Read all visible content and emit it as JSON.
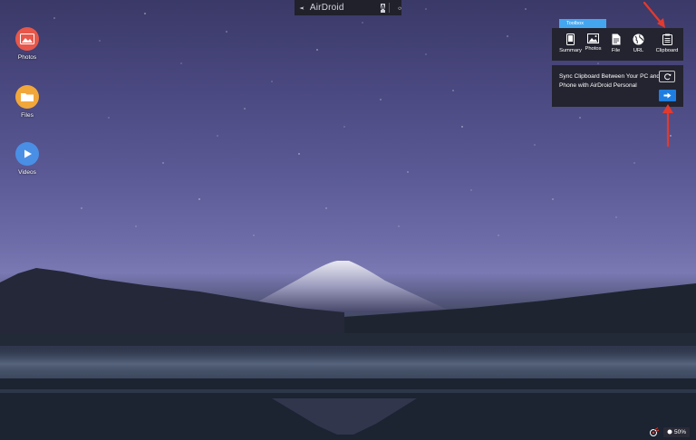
{
  "topbar": {
    "brand": "AirDroid",
    "account_letter": "A",
    "logo_icon": "paper-plane-icon",
    "power_icon": "power-icon"
  },
  "desktop": {
    "icons": [
      {
        "label": "Photos",
        "icon": "photos-icon",
        "color": "#e8574a"
      },
      {
        "label": "Files",
        "icon": "folder-icon",
        "color": "#f1a73a"
      },
      {
        "label": "Videos",
        "icon": "play-icon",
        "color": "#4a8fe6"
      }
    ]
  },
  "toolbox": {
    "tab_label": "Toolbox",
    "items": [
      {
        "label": "Summary",
        "icon": "phone-icon"
      },
      {
        "label": "Photos",
        "icon": "image-icon"
      },
      {
        "label": "File",
        "icon": "file-icon"
      },
      {
        "label": "URL",
        "icon": "globe-icon"
      },
      {
        "label": "Clipboard",
        "icon": "clipboard-icon"
      }
    ]
  },
  "clipboard_panel": {
    "message": "Sync Clipboard Between Your PC and Phone with AirDroid Personal",
    "refresh_icon": "refresh-icon",
    "send_icon": "arrow-right-icon"
  },
  "status": {
    "battery": "50%",
    "battery_icon": "battery-icon",
    "notification_icon": "satellite-icon"
  },
  "colors": {
    "accent": "#1f7de0",
    "toolbox_tab": "#45a6f0",
    "panel_bg": "#23242f",
    "annotation_arrow": "#e33a2e"
  }
}
